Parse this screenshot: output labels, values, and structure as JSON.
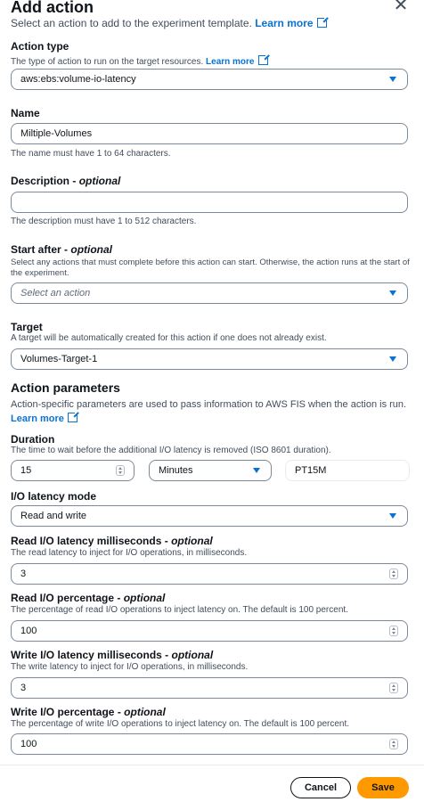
{
  "modal": {
    "title": "Add action",
    "close_icon": "close-icon",
    "intro": "Select an action to add to the experiment template.",
    "learn_more": "Learn more"
  },
  "action_type": {
    "label": "Action type",
    "help": "The type of action to run on the target resources.",
    "learn_more": "Learn more",
    "value": "aws:ebs:volume-io-latency"
  },
  "name": {
    "label": "Name",
    "value": "Miltiple-Volumes",
    "help": "The name must have 1 to 64 characters."
  },
  "description": {
    "label": "Description - ",
    "optional": "optional",
    "value": "",
    "help": "The description must have 1 to 512 characters."
  },
  "start_after": {
    "label": "Start after - ",
    "optional": "optional",
    "help": "Select any actions that must complete before this action can start. Otherwise, the action runs at the start of the experiment.",
    "placeholder": "Select an action"
  },
  "target": {
    "label": "Target",
    "help": "A target will be automatically created for this action if one does not already exist.",
    "value": "Volumes-Target-1"
  },
  "action_parameters": {
    "heading": "Action parameters",
    "help": "Action-specific parameters are used to pass information to AWS FIS when the action is run.",
    "learn_more": "Learn more"
  },
  "duration": {
    "label": "Duration",
    "help": "The time to wait before the additional I/O latency is removed (ISO 8601 duration).",
    "value": "15",
    "unit": "Minutes",
    "iso": "PT15M"
  },
  "io_latency_mode": {
    "label": "I/O latency mode",
    "value": "Read and write"
  },
  "read_latency": {
    "label": "Read I/O latency milliseconds - ",
    "optional": "optional",
    "help": "The read latency to inject for I/O operations, in milliseconds.",
    "value": "3"
  },
  "read_percentage": {
    "label": "Read I/O percentage - ",
    "optional": "optional",
    "help": "The percentage of read I/O operations to inject latency on. The default is 100 percent.",
    "value": "100"
  },
  "write_latency": {
    "label": "Write I/O latency milliseconds - ",
    "optional": "optional",
    "help": "The write latency to inject for I/O operations, in milliseconds.",
    "value": "3"
  },
  "write_percentage": {
    "label": "Write I/O percentage - ",
    "optional": "optional",
    "help": "The percentage of write I/O operations to inject latency on. The default is 100 percent.",
    "value": "100"
  },
  "footer": {
    "cancel": "Cancel",
    "save": "Save"
  },
  "colors": {
    "link": "#0972d3",
    "primary_button": "#ff9900",
    "text": "#0f141a"
  }
}
